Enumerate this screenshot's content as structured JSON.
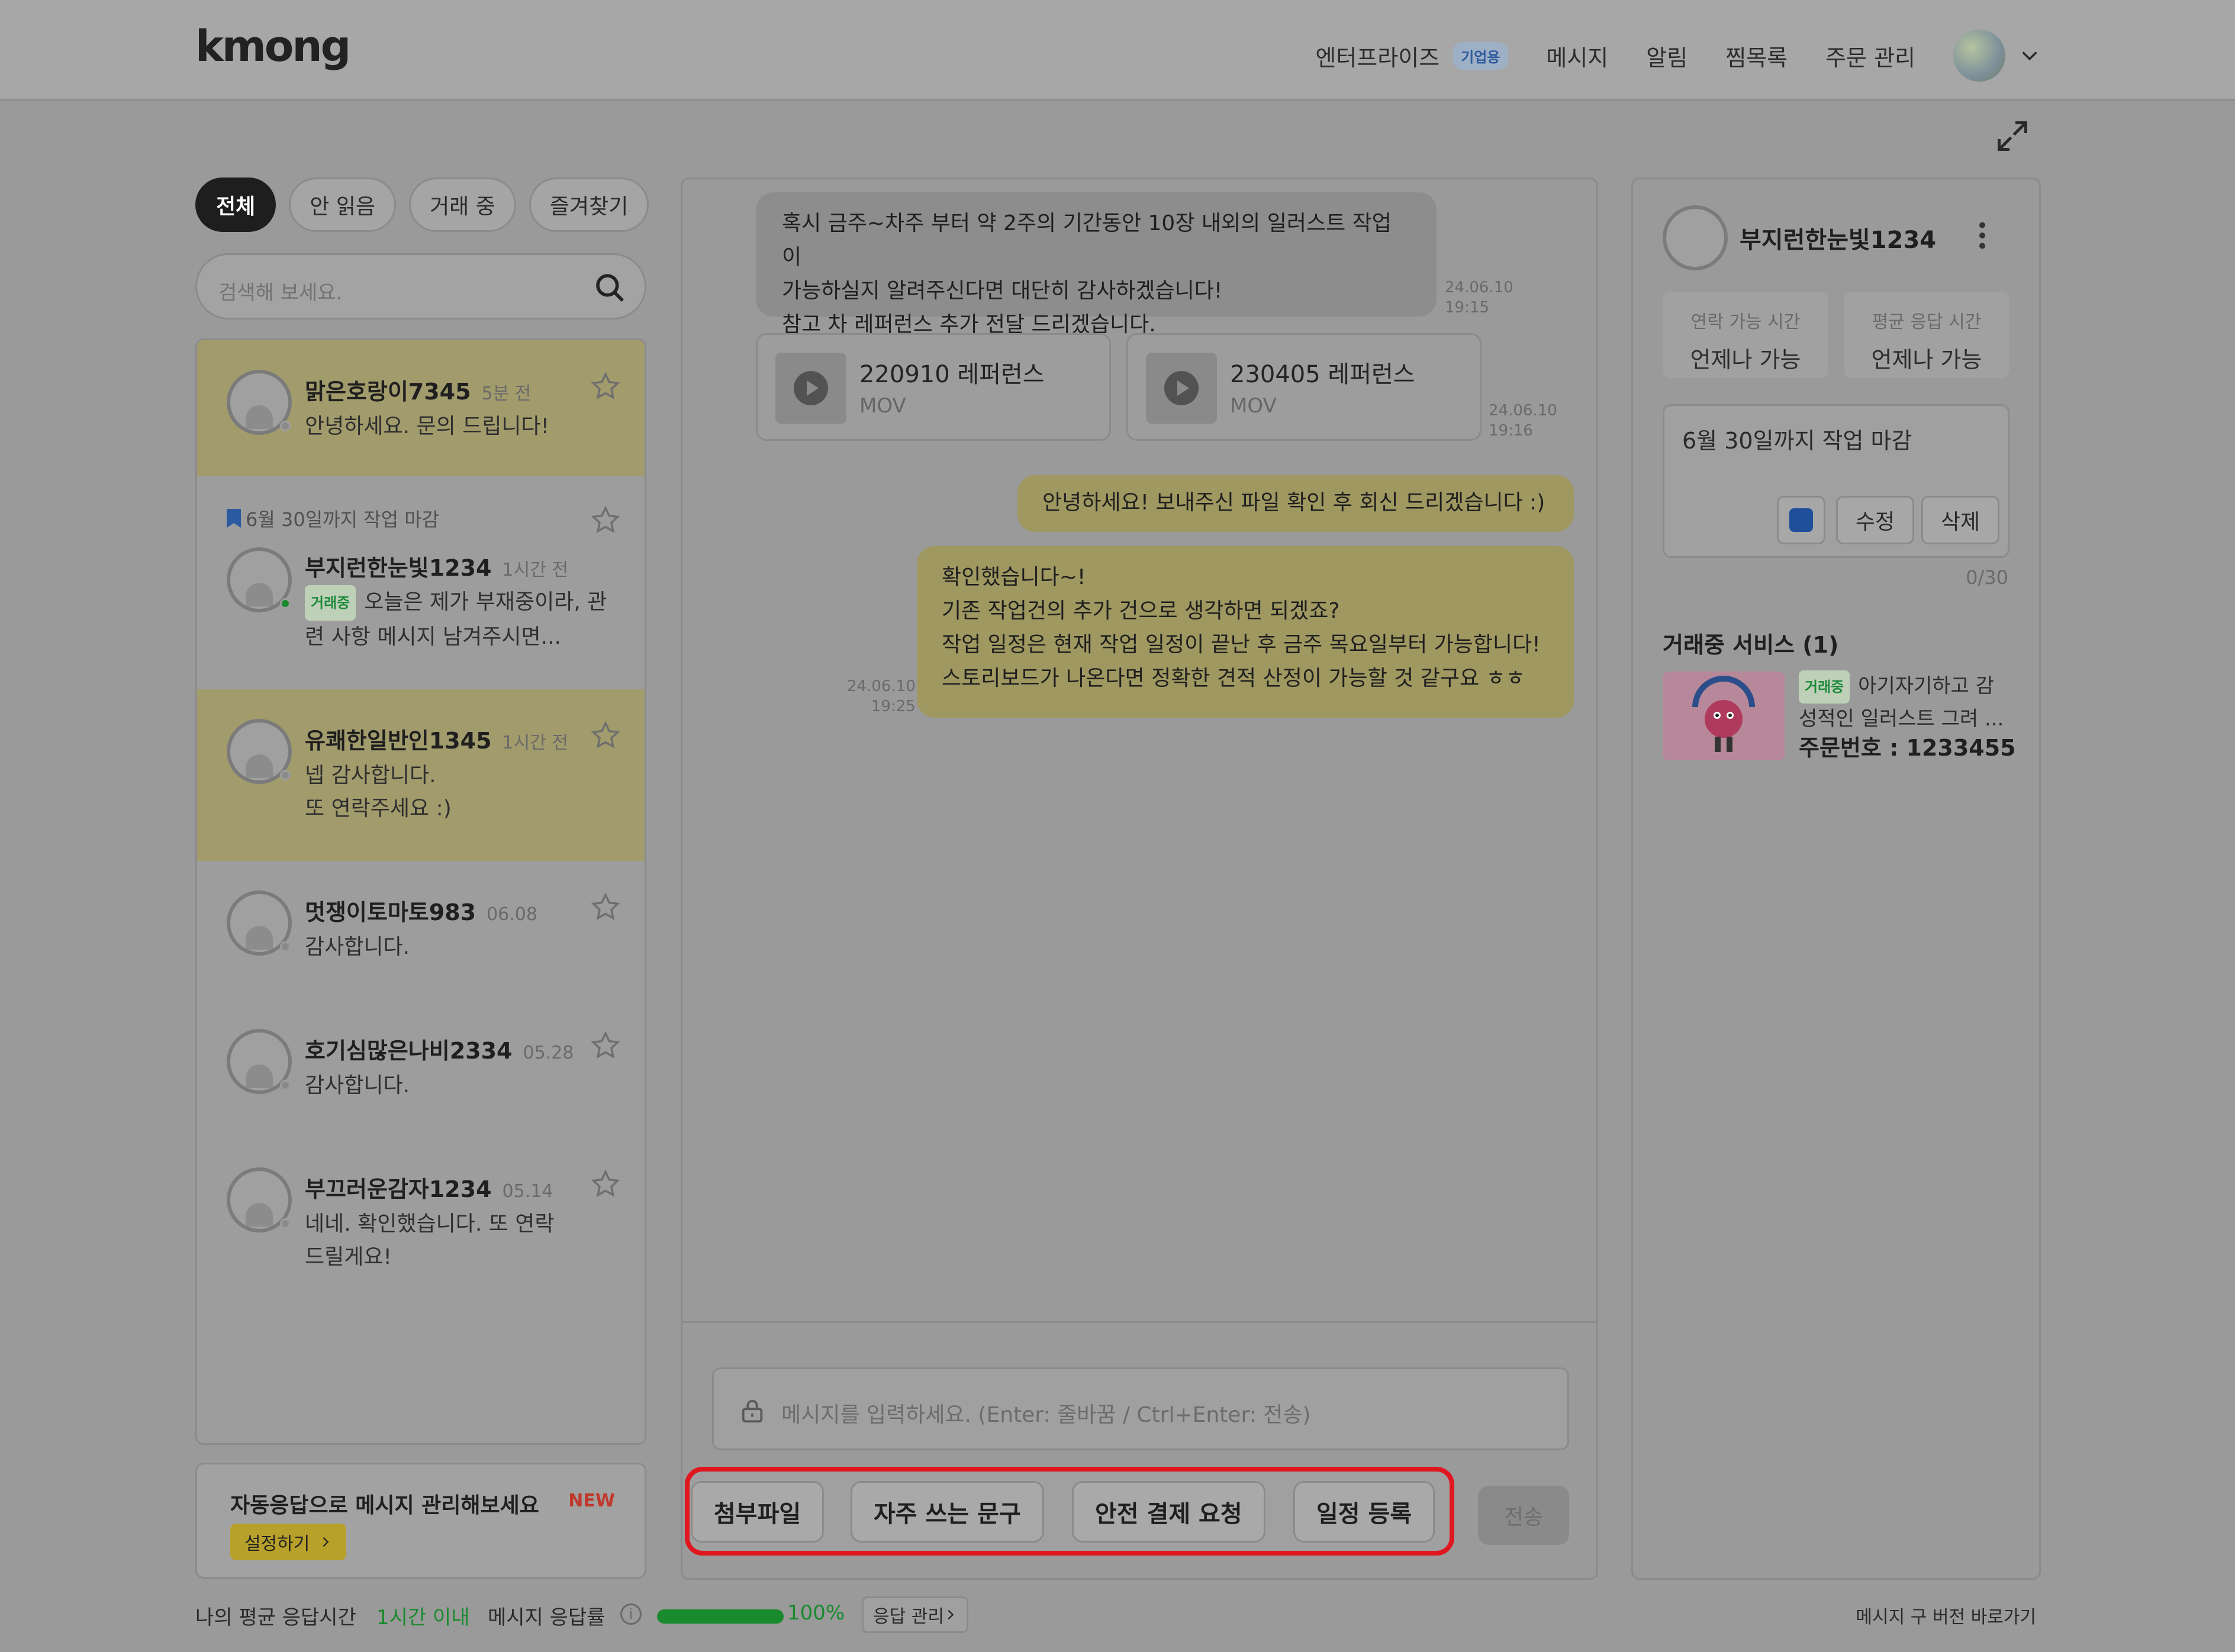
{
  "header": {
    "logo": "kmong",
    "nav": {
      "enterprise": "엔터프라이즈",
      "enterprise_badge": "기업용",
      "messages": "메시지",
      "notifications": "알림",
      "wishlist": "찜목록",
      "orders": "주문 관리"
    }
  },
  "filters": [
    "전체",
    "안 읽음",
    "거래 중",
    "즐겨찾기"
  ],
  "search": {
    "placeholder": "검색해 보세요."
  },
  "conversations": [
    {
      "name": "맑은호랑이7345",
      "time": "5분 전",
      "preview": "안녕하세요. 문의 드립니다!"
    },
    {
      "pin": "6월 30일까지 작업 마감",
      "name": "부지런한눈빛1234",
      "time": "1시간 전",
      "tag": "거래중",
      "preview": "오늘은 제가 부재중이라, 관련 사항 메시지 남겨주시면..."
    },
    {
      "name": "유쾌한일반인1345",
      "time": "1시간 전",
      "preview_line1": "넵 감사합니다.",
      "preview_line2": "또 연락주세요 :)"
    },
    {
      "name": "멋쟁이토마토983",
      "time": "06.08",
      "preview": "감사합니다."
    },
    {
      "name": "호기심많은나비2334",
      "time": "05.28",
      "preview": "감사합니다."
    },
    {
      "name": "부끄러운감자1234",
      "time": "05.14",
      "preview_line1": "네네. 확인했습니다. 또 연락",
      "preview_line2": "드릴게요!"
    }
  ],
  "auto_reply": {
    "title": "자동응답으로 메시지 관리해보세요",
    "new": "NEW",
    "button": "설정하기"
  },
  "chat": {
    "msg1": {
      "line1": "혹시 금주~차주 부터 약 2주의 기간동안 10장 내외의 일러스트 작업이",
      "line2": "가능하실지 알려주신다면 대단히 감사하겠습니다!",
      "line3": "참고 차 레퍼런스 추가 전달 드리겠습니다.",
      "date": "24.06.10",
      "time": "19:15"
    },
    "files": [
      {
        "name": "220910 레퍼런스",
        "type": "MOV"
      },
      {
        "name": "230405 레퍼런스",
        "type": "MOV"
      }
    ],
    "files_date": "24.06.10",
    "files_time": "19:16",
    "msg2": "안녕하세요! 보내주신 파일 확인 후 회신 드리겠습니다 :)",
    "msg3": {
      "line1": "확인했습니다~!",
      "line2": "기존 작업건의 추가 건으로 생각하면 되겠죠?",
      "line3": "작업 일정은 현재 작업 일정이 끝난 후 금주 목요일부터 가능합니다!",
      "line4": "스토리보드가 나온다면 정확한 견적 산정이 가능할 것 같구요 ㅎㅎ",
      "date": "24.06.10",
      "time": "19:25"
    },
    "input_placeholder": "메시지를 입력하세요. (Enter: 줄바꿈 / Ctrl+Enter: 전송)",
    "actions": [
      "첨부파일",
      "자주 쓰는 문구",
      "안전 결제 요청",
      "일정 등록"
    ],
    "send": "전송"
  },
  "profile": {
    "name": "부지런한눈빛1234",
    "contact_label": "연락 가능 시간",
    "contact_value": "언제나 가능",
    "response_label": "평균 응답 시간",
    "response_value": "언제나 가능",
    "memo": "6월 30일까지 작업 마감",
    "edit": "수정",
    "delete": "삭제",
    "counter": "0/30",
    "service_title": "거래중 서비스 (1)",
    "service_tag": "거래중",
    "service_text": "아기자기하고 감성적인 일러스트 그려 ...",
    "order_number": "주문번호 : 1233455"
  },
  "footer": {
    "avg_label": "나의 평균 응답시간",
    "avg_value": "1시간 이내",
    "rate_label": "메시지 응답률",
    "rate_value": "100%",
    "rate_fraction": 1.0,
    "manage": "응답 관리",
    "old_version": "메시지 구 버전 바로가기"
  },
  "colors": {
    "highlight": "#e0171f",
    "accent_green": "#1a8a2e",
    "badge_blue": "#2f5a9e"
  }
}
